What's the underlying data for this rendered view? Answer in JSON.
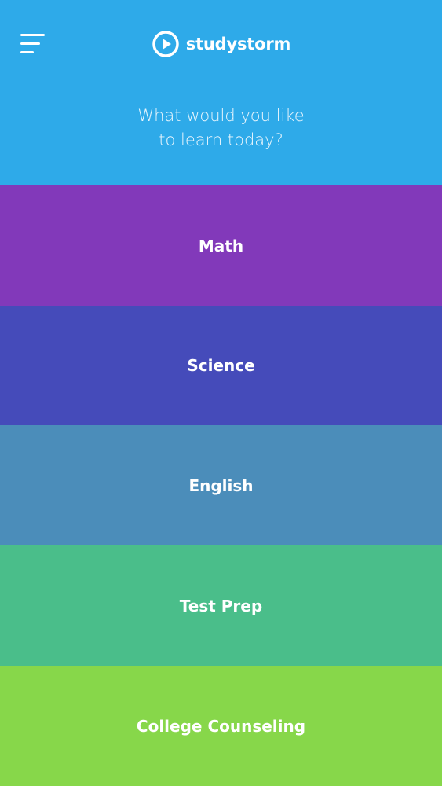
{
  "header": {
    "brand": "studystorm",
    "prompt_line1": "What would you like",
    "prompt_line2": "to learn today?",
    "background": "#2EAAE9",
    "menu_icon": "hamburger-menu-icon",
    "logo_icon": "play-circle-icon"
  },
  "subjects": [
    {
      "label": "Math",
      "color": "#8239BA"
    },
    {
      "label": "Science",
      "color": "#454BBA"
    },
    {
      "label": "English",
      "color": "#4B8DBA"
    },
    {
      "label": "Test Prep",
      "color": "#4ABE8A"
    },
    {
      "label": "College Counseling",
      "color": "#87D74A"
    }
  ]
}
